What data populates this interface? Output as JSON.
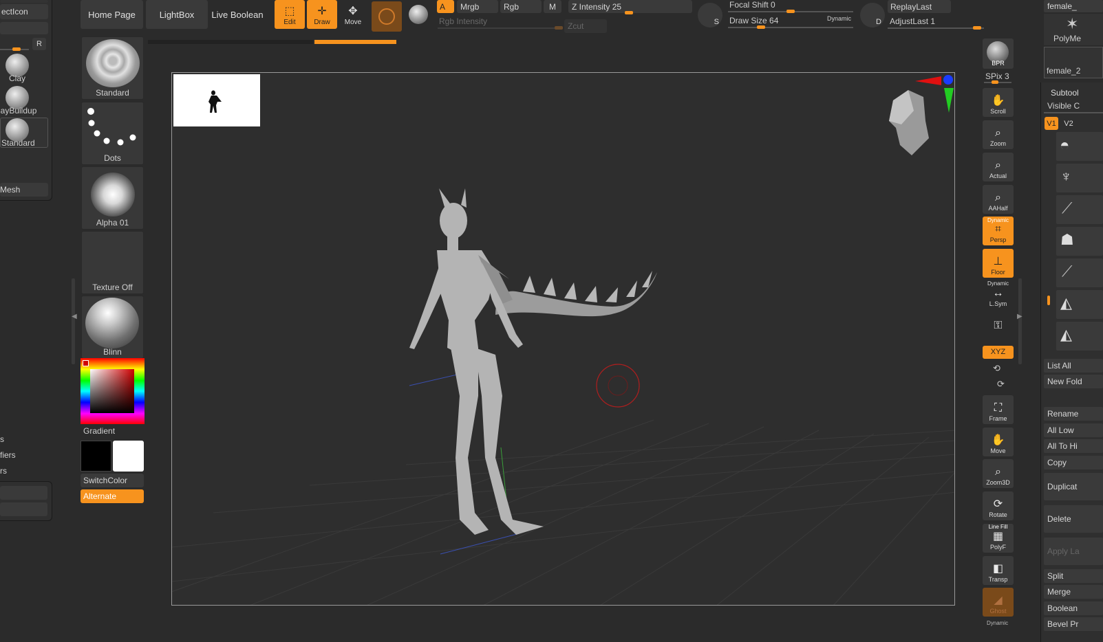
{
  "colors": {
    "accent": "#f7931e",
    "panel": "#383838",
    "bg": "#2b2b2b",
    "canvas_border": "#9a9a9a"
  },
  "left_tray": {
    "items": [
      {
        "label": "ectIcon"
      },
      {
        "label": "Clay"
      },
      {
        "label": "layBuildup"
      },
      {
        "label": "Standard"
      },
      {
        "label": "Mesh"
      }
    ],
    "r_button": "R",
    "menu_fragments": [
      "s",
      "fiers",
      "rs"
    ]
  },
  "topbar": {
    "home_page": "Home Page",
    "lightbox": "LightBox",
    "live_boolean": "Live Boolean",
    "edit": "Edit",
    "draw": "Draw",
    "move": "Move",
    "a_toggle": "A",
    "mrgb": "Mrgb",
    "rgb": "Rgb",
    "m": "M",
    "rgb_intensity": "Rgb Intensity",
    "z_intensity": "Z Intensity",
    "z_intensity_value": "25",
    "zcut": "Zcut",
    "focal_shift": "Focal Shift",
    "focal_shift_value": "0",
    "draw_size": "Draw Size",
    "draw_size_value": "64",
    "dynamic": "Dynamic",
    "replay_last": "ReplayLast",
    "adjust_last": "AdjustLast",
    "adjust_last_value": "1",
    "s_icon": "S",
    "d_icon": "D"
  },
  "tool_column": {
    "brush": "Standard",
    "stroke": "Dots",
    "alpha": "Alpha 01",
    "texture": "Texture Off",
    "material": "Blinn",
    "gradient": "Gradient",
    "switch_color": "SwitchColor",
    "alternate": "Alternate"
  },
  "right_shelf": {
    "bpr": "BPR",
    "spix": "SPix 3",
    "scroll": "Scroll",
    "zoom": "Zoom",
    "actual": "Actual",
    "aahalf": "AAHalf",
    "persp_top": "Dynamic",
    "persp": "Persp",
    "floor": "Floor",
    "lsym_top": "Dynamic",
    "lsym": "L.Sym",
    "xyz": "XYZ",
    "frame": "Frame",
    "move": "Move",
    "zoom3d": "Zoom3D",
    "rotate": "Rotate",
    "polyf_top": "Line Fill",
    "polyf": "PolyF",
    "transp": "Transp",
    "ghost": "Ghost",
    "bottom": "Dynamic"
  },
  "subtool_panel": {
    "top_label": "female_",
    "polymesh": "PolyMe",
    "female_2": "female_2",
    "subtool": "Subtool",
    "visible": "Visible C",
    "v1": "V1",
    "v2": "V2",
    "list_all": "List All",
    "new_folder": "New Fold",
    "rename": "Rename",
    "all_low": "All Low",
    "all_to_high": "All To Hi",
    "copy": "Copy",
    "duplicate": "Duplicat",
    "delete": "Delete",
    "apply_layers": "Apply La",
    "split": "Split",
    "merge": "Merge",
    "boolean": "Boolean",
    "bevel": "Bevel Pr"
  }
}
